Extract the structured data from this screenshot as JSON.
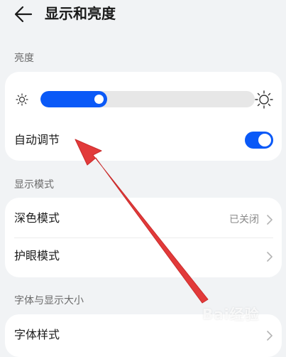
{
  "header": {
    "title": "显示和亮度"
  },
  "brightness": {
    "section_label": "亮度",
    "level": 0.31,
    "auto_label": "自动调节",
    "auto_enabled": true
  },
  "display_mode": {
    "section_label": "显示模式",
    "dark_mode_label": "深色模式",
    "dark_mode_value": "已关闭",
    "eye_comfort_label": "护眼模式"
  },
  "font": {
    "section_label": "字体与显示大小",
    "font_style_label": "字体样式"
  },
  "watermark_text": "Bai经验",
  "colors": {
    "accent": "#0a59f7",
    "background": "#f1f3f5",
    "card": "#ffffff",
    "annotation_arrow": "#e23a3a"
  }
}
